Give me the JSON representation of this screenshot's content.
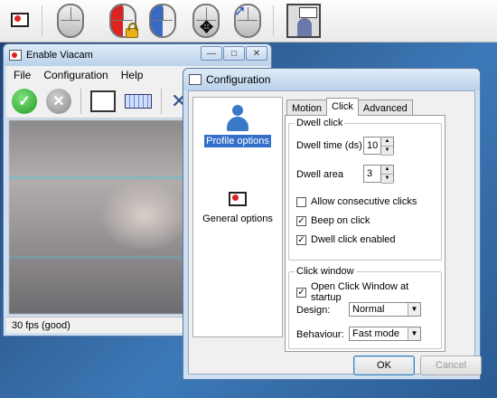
{
  "topbar": {
    "buttons": [
      "app-icon",
      "mouse-icon",
      "mouse-lock-icon",
      "mouse-blue-icon",
      "mouse-move-icon",
      "mouse-rotate-icon",
      "screen-icon"
    ]
  },
  "viacam": {
    "title": "Enable Viacam",
    "menu": [
      "File",
      "Configuration",
      "Help"
    ],
    "status": "30 fps (good)"
  },
  "config": {
    "title": "Configuration",
    "left_items": [
      "Profile options",
      "General options"
    ],
    "tabs": [
      "Motion",
      "Click",
      "Advanced"
    ],
    "dwell": {
      "title": "Dwell click",
      "time_label": "Dwell time (ds)",
      "time_value": "10",
      "area_label": "Dwell area",
      "area_value": "3",
      "consecutive": "Allow consecutive clicks",
      "consecutive_checked": false,
      "beep": "Beep on click",
      "beep_checked": true,
      "enabled": "Dwell click enabled",
      "enabled_checked": true
    },
    "clickwin": {
      "title": "Click window",
      "open_startup": "Open Click Window at startup",
      "open_checked": true,
      "design_label": "Design:",
      "design_value": "Normal",
      "behaviour_label": "Behaviour:",
      "behaviour_value": "Fast mode"
    },
    "ok": "OK",
    "cancel": "Cancel"
  }
}
